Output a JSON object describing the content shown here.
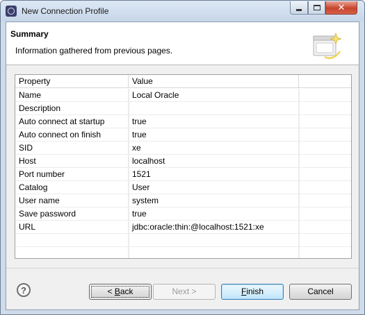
{
  "window": {
    "title": "New Connection Profile"
  },
  "banner": {
    "title": "Summary",
    "description": "Information gathered from previous pages."
  },
  "table": {
    "headers": [
      "Property",
      "Value",
      ""
    ],
    "rows": [
      {
        "property": "Name",
        "value": "Local Oracle"
      },
      {
        "property": "Description",
        "value": ""
      },
      {
        "property": "Auto connect at startup",
        "value": "true"
      },
      {
        "property": "Auto connect on finish",
        "value": "true"
      },
      {
        "property": "SID",
        "value": "xe"
      },
      {
        "property": "Host",
        "value": "localhost"
      },
      {
        "property": "Port number",
        "value": "1521"
      },
      {
        "property": "Catalog",
        "value": "User"
      },
      {
        "property": "User name",
        "value": "system"
      },
      {
        "property": "Save password",
        "value": "true"
      },
      {
        "property": "URL",
        "value": "jdbc:oracle:thin:@localhost:1521:xe"
      },
      {
        "property": "",
        "value": ""
      },
      {
        "property": "",
        "value": ""
      }
    ]
  },
  "buttons": {
    "help": "?",
    "back_prefix": "< ",
    "back_mnemonic": "B",
    "back_rest": "ack",
    "next": "Next >",
    "finish_mnemonic": "F",
    "finish_rest": "inish",
    "cancel": "Cancel"
  },
  "icons": {
    "app": "eclipse-icon",
    "wizard": "new-connection-wizard-icon",
    "minimize": "minimize-icon",
    "maximize": "maximize-icon",
    "close": "close-icon"
  }
}
